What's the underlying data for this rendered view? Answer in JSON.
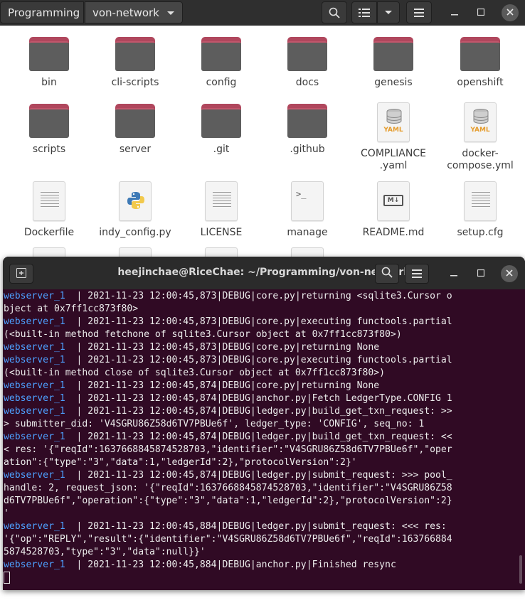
{
  "file_manager": {
    "breadcrumb": [
      "Programming",
      "von-network"
    ],
    "items": [
      {
        "label": "bin",
        "icon": "folder-icon"
      },
      {
        "label": "cli-scripts",
        "icon": "folder-icon"
      },
      {
        "label": "config",
        "icon": "folder-icon"
      },
      {
        "label": "docs",
        "icon": "folder-icon"
      },
      {
        "label": "genesis",
        "icon": "folder-icon"
      },
      {
        "label": "openshift",
        "icon": "folder-icon"
      },
      {
        "label": "scripts",
        "icon": "folder-icon"
      },
      {
        "label": "server",
        "icon": "folder-icon"
      },
      {
        "label": ".git",
        "icon": "folder-icon"
      },
      {
        "label": ".github",
        "icon": "folder-icon"
      },
      {
        "label": "COMPLIANCE\n.yaml",
        "icon": "yaml-file-icon"
      },
      {
        "label": "docker-\ncompose.yml",
        "icon": "yaml-file-icon"
      },
      {
        "label": "Dockerfile",
        "icon": "text-file-icon"
      },
      {
        "label": "indy_config.py",
        "icon": "python-file-icon"
      },
      {
        "label": "LICENSE",
        "icon": "text-file-icon"
      },
      {
        "label": "manage",
        "icon": "script-file-icon"
      },
      {
        "label": "README.md",
        "icon": "markdown-file-icon"
      },
      {
        "label": "setup.cfg",
        "icon": "text-file-icon"
      }
    ],
    "yaml_badge": "YAML",
    "md_badge": "M↓",
    "shell_prompt_glyph": ">_"
  },
  "terminal": {
    "title": "heejinchae@RiceChae: ~/Programming/von-network",
    "lines": [
      [
        {
          "t": "webserver_1  ",
          "c": "src"
        },
        {
          "t": "| 2021-11-23 12:00:45,873|DEBUG|core.py|returning <sqlite3.Cursor o"
        }
      ],
      [
        {
          "t": "bject at 0x7ff1cc873f80>"
        }
      ],
      [
        {
          "t": "webserver_1  ",
          "c": "src"
        },
        {
          "t": "| 2021-11-23 12:00:45,873|DEBUG|core.py|executing functools.partial"
        }
      ],
      [
        {
          "t": "(<built-in method fetchone of sqlite3.Cursor object at 0x7ff1cc873f80>)"
        }
      ],
      [
        {
          "t": "webserver_1  ",
          "c": "src"
        },
        {
          "t": "| 2021-11-23 12:00:45,873|DEBUG|core.py|returning None"
        }
      ],
      [
        {
          "t": "webserver_1  ",
          "c": "src"
        },
        {
          "t": "| 2021-11-23 12:00:45,873|DEBUG|core.py|executing functools.partial"
        }
      ],
      [
        {
          "t": "(<built-in method close of sqlite3.Cursor object at 0x7ff1cc873f80>)"
        }
      ],
      [
        {
          "t": "webserver_1  ",
          "c": "src"
        },
        {
          "t": "| 2021-11-23 12:00:45,874|DEBUG|core.py|returning None"
        }
      ],
      [
        {
          "t": "webserver_1  ",
          "c": "src"
        },
        {
          "t": "| 2021-11-23 12:00:45,874|DEBUG|anchor.py|Fetch LedgerType.CONFIG 1"
        }
      ],
      [
        {
          "t": "webserver_1  ",
          "c": "src"
        },
        {
          "t": "| 2021-11-23 12:00:45,874|DEBUG|ledger.py|build_get_txn_request: >>"
        }
      ],
      [
        {
          "t": "> submitter_did: 'V4SGRU86Z58d6TV7PBUe6f', ledger_type: 'CONFIG', seq_no: 1"
        }
      ],
      [
        {
          "t": "webserver_1  ",
          "c": "src"
        },
        {
          "t": "| 2021-11-23 12:00:45,874|DEBUG|ledger.py|build_get_txn_request: <<"
        }
      ],
      [
        {
          "t": "< res: '{\"reqId\":1637668845874528703,\"identifier\":\"V4SGRU86Z58d6TV7PBUe6f\",\"oper"
        }
      ],
      [
        {
          "t": "ation\":{\"type\":\"3\",\"data\":1,\"ledgerId\":2},\"protocolVersion\":2}'"
        }
      ],
      [
        {
          "t": "webserver_1  ",
          "c": "src"
        },
        {
          "t": "| 2021-11-23 12:00:45,874|DEBUG|ledger.py|submit_request: >>> pool_"
        }
      ],
      [
        {
          "t": "handle: 2, request_json: '{\"reqId\":1637668845874528703,\"identifier\":\"V4SGRU86Z58"
        }
      ],
      [
        {
          "t": "d6TV7PBUe6f\",\"operation\":{\"type\":\"3\",\"data\":1,\"ledgerId\":2},\"protocolVersion\":2}"
        }
      ],
      [
        {
          "t": "'"
        }
      ],
      [
        {
          "t": "webserver_1  ",
          "c": "src"
        },
        {
          "t": "| 2021-11-23 12:00:45,884|DEBUG|ledger.py|submit_request: <<< res:"
        }
      ],
      [
        {
          "t": "'{\"op\":\"REPLY\",\"result\":{\"identifier\":\"V4SGRU86Z58d6TV7PBUe6f\",\"reqId\":163766884"
        }
      ],
      [
        {
          "t": "5874528703,\"type\":\"3\",\"data\":null}}'"
        }
      ],
      [
        {
          "t": "webserver_1  ",
          "c": "src"
        },
        {
          "t": "| 2021-11-23 12:00:45,884|DEBUG|anchor.py|Finished resync"
        }
      ]
    ]
  },
  "colors": {
    "terminal_bg": "#300a24",
    "terminal_source": "#4da0ff",
    "folder_accent": "#b0475d"
  }
}
